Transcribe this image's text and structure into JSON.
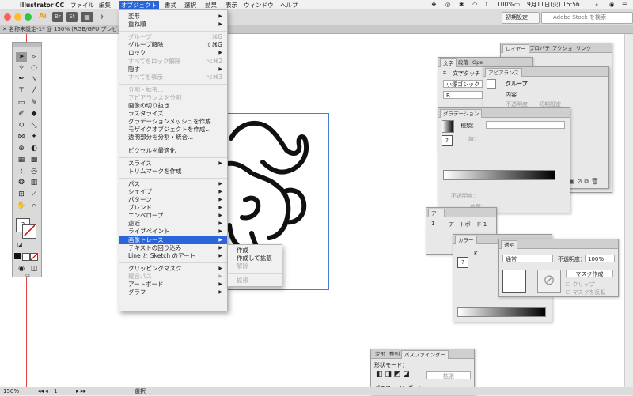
{
  "menubar": {
    "app_name": "Illustrator CC",
    "items": [
      "ファイル",
      "編集",
      "オブジェクト",
      "書式",
      "選択",
      "効果",
      "表示",
      "ウィンドウ",
      "ヘルプ"
    ],
    "active_index": 2,
    "battery": "100%",
    "clock": "9月11日(火)  15:56"
  },
  "toolbar": {
    "ai_logo": "Ai",
    "br_label": "Br",
    "st_label": "St",
    "workspace": "初期設定",
    "stock_placeholder": "Adobe Stock を検索"
  },
  "document_tab": {
    "title": "名称未設定-1* @ 150% (RGB/GPU プレビュー)"
  },
  "object_menu": {
    "items": [
      {
        "label": "変形",
        "submenu": true
      },
      {
        "label": "重ね順",
        "submenu": true
      },
      {
        "sep": true
      },
      {
        "label": "グループ",
        "shortcut": "⌘G",
        "disabled": true
      },
      {
        "label": "グループ解除",
        "shortcut": "⇧⌘G"
      },
      {
        "label": "ロック",
        "submenu": true
      },
      {
        "label": "すべてをロック解除",
        "shortcut": "⌥⌘2",
        "disabled": true
      },
      {
        "label": "隠す",
        "submenu": true
      },
      {
        "label": "すべてを表示",
        "shortcut": "⌥⌘3",
        "disabled": true
      },
      {
        "sep": true
      },
      {
        "label": "分割・拡張...",
        "disabled": true
      },
      {
        "label": "アピアランスを分割",
        "disabled": true
      },
      {
        "label": "画像の切り抜き"
      },
      {
        "label": "ラスタライズ..."
      },
      {
        "label": "グラデーションメッシュを作成..."
      },
      {
        "label": "モザイクオブジェクトを作成..."
      },
      {
        "label": "透明部分を分割・統合..."
      },
      {
        "sep": true
      },
      {
        "label": "ピクセルを最適化"
      },
      {
        "sep": true
      },
      {
        "label": "スライス",
        "submenu": true
      },
      {
        "label": "トリムマークを作成"
      },
      {
        "sep": true
      },
      {
        "label": "パス",
        "submenu": true
      },
      {
        "label": "シェイプ",
        "submenu": true
      },
      {
        "label": "パターン",
        "submenu": true
      },
      {
        "label": "ブレンド",
        "submenu": true
      },
      {
        "label": "エンベロープ",
        "submenu": true
      },
      {
        "label": "遠近",
        "submenu": true
      },
      {
        "label": "ライブペイント",
        "submenu": true
      },
      {
        "label": "画像トレース",
        "submenu": true,
        "highlighted": true
      },
      {
        "label": "テキストの回り込み",
        "submenu": true
      },
      {
        "label": "Line と Sketch のアート",
        "submenu": true
      },
      {
        "sep": true
      },
      {
        "label": "クリッピングマスク",
        "submenu": true
      },
      {
        "label": "複合パス",
        "submenu": true,
        "disabled": true
      },
      {
        "label": "アートボード",
        "submenu": true
      },
      {
        "label": "グラフ",
        "submenu": true
      }
    ]
  },
  "trace_submenu": {
    "items": [
      {
        "label": "作成"
      },
      {
        "label": "作成して拡張"
      },
      {
        "label": "解除",
        "disabled": true
      },
      {
        "sep": true
      },
      {
        "label": "拡張",
        "disabled": true
      }
    ]
  },
  "layers_panel": {
    "tabs": [
      "レイヤー",
      "プロパテ",
      "アクショ",
      "リンク"
    ]
  },
  "character_panel": {
    "tabs": [
      "文字",
      "段落",
      "Ope"
    ],
    "touch_label": "文字タッチ",
    "font": "小塚ゴシック",
    "style": "R"
  },
  "appearance_panel": {
    "tab": "アピアランス",
    "group_label": "グループ",
    "content_label": "内容",
    "opacity_label": "不透明度：",
    "opacity_value": "初期設定"
  },
  "gradient_panel": {
    "tab": "グラデーション",
    "type_label": "種類：",
    "opacity_label": "不透明度：",
    "position_label": "位置：",
    "stroke_label": "線："
  },
  "artboard_panel": {
    "tab": "アー",
    "index": "1",
    "name": "アートボード 1"
  },
  "color_panel": {
    "tab": "カラー",
    "k_label": "K"
  },
  "transparency_panel": {
    "tab": "透明",
    "mode": "通常",
    "opacity_label": "不透明度：",
    "opacity_value": "100%",
    "mask_button": "マスク作成",
    "clip_label": "クリップ",
    "invert_label": "マスクを反転"
  },
  "pathfinder_panel": {
    "tabs": [
      "変形",
      "整列",
      "パスファインダー"
    ],
    "shape_mode_label": "形状モード：",
    "expand_button": "拡張",
    "pathfinder_label": "パスファインダー："
  },
  "statusbar": {
    "zoom": "150%",
    "artboard": "1",
    "tool": "選択"
  }
}
